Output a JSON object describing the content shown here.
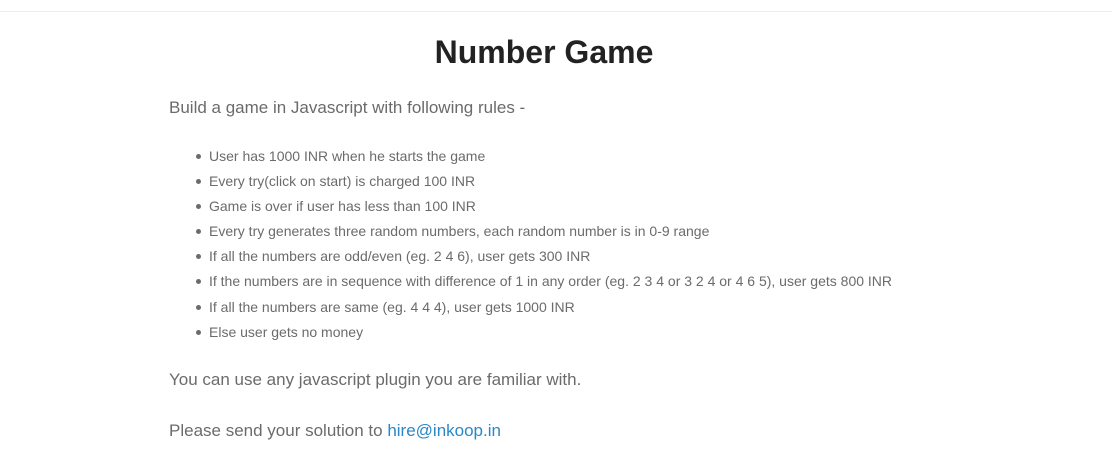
{
  "page": {
    "title": "Number Game",
    "intro": "Build a game in Javascript with following rules -",
    "rules": [
      "User has 1000 INR when he starts the game",
      "Every try(click on start) is charged 100 INR",
      "Game is over if user has less than 100 INR",
      "Every try generates three random numbers, each random number is in 0-9 range",
      "If all the numbers are odd/even (eg. 2 4 6), user gets 300 INR",
      "If the numbers are in sequence with difference of 1 in any order (eg. 2 3 4 or 3 2 4 or 4 6 5), user gets 800 INR",
      "If all the numbers are same (eg. 4 4 4), user gets 1000 INR",
      "Else user gets no money"
    ],
    "plugin_note": "You can use any javascript plugin you are familiar with.",
    "send_prefix": "Please send your solution to ",
    "email": "hire@inkoop.in"
  },
  "colors": {
    "title": "#222222",
    "body_text": "#6b6b6b",
    "link": "#2a88c8"
  }
}
